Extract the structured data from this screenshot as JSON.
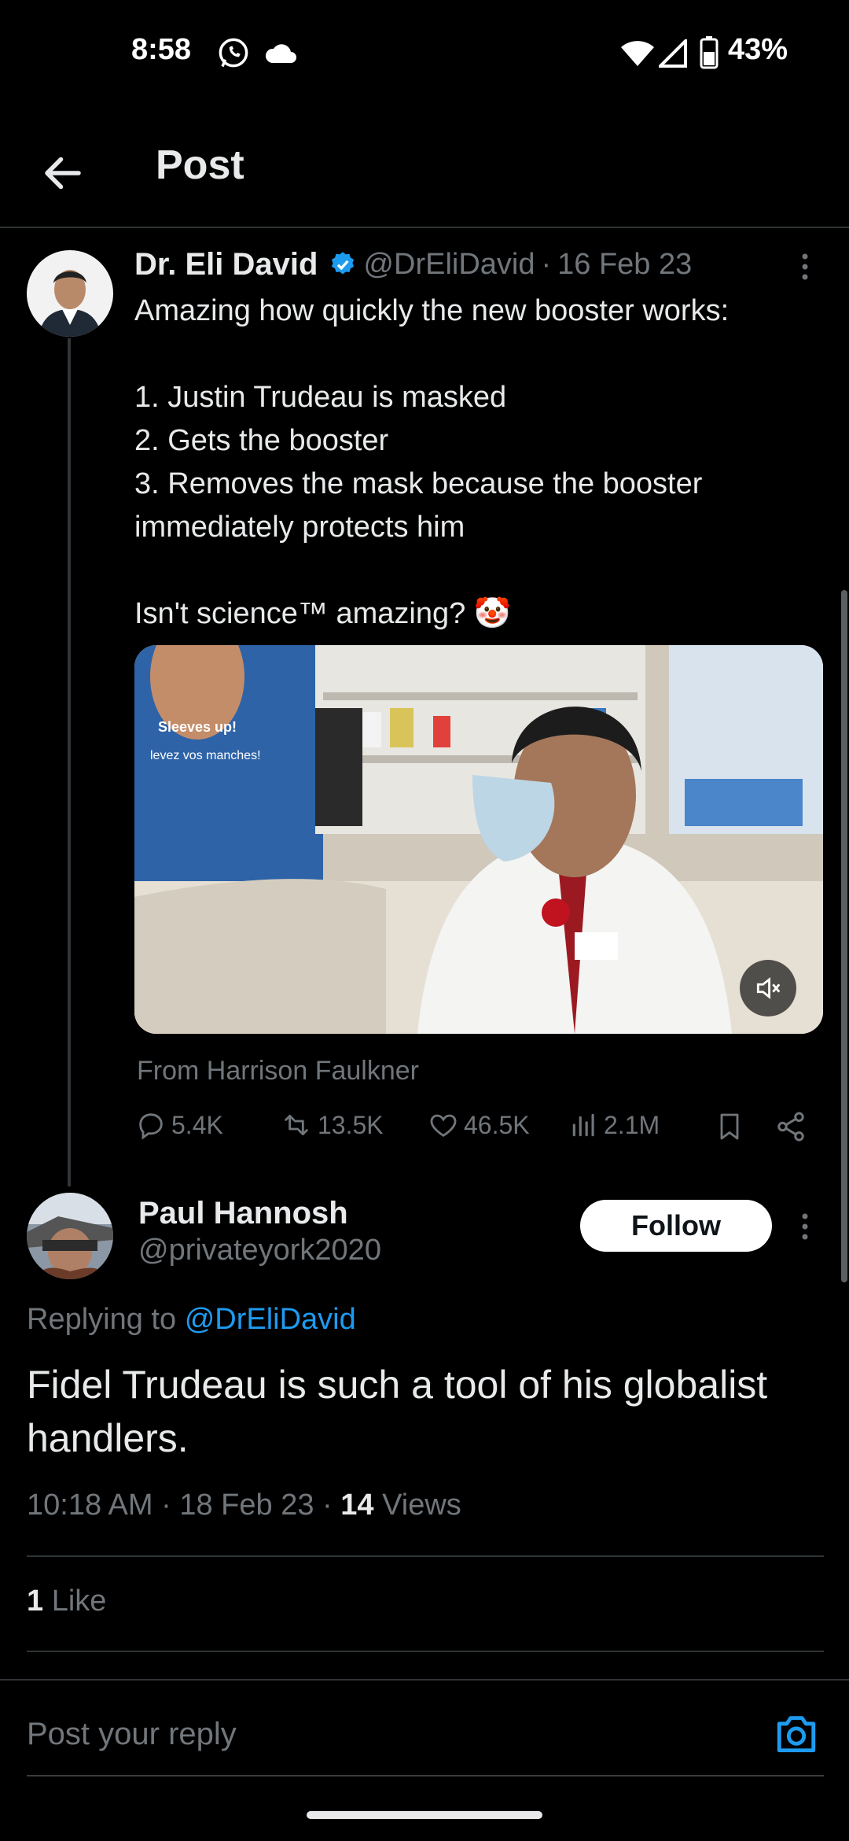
{
  "status_bar": {
    "time": "8:58",
    "battery": "43%"
  },
  "header": {
    "title": "Post"
  },
  "parent_post": {
    "author_name": "Dr. Eli David",
    "author_handle": "@DrEliDavid",
    "separator": "·",
    "date": "16 Feb 23",
    "body": "Amazing how quickly the new booster works:\n\n1. Justin Trudeau is masked\n2. Gets the booster\n3. Removes the mask because the booster immediately protects him\n\nIsn't science™ amazing? 🤡",
    "media_text": {
      "poster_line1": "Sleeves up!",
      "poster_line2": "levez vos manches!"
    },
    "attribution": "From Harrison Faulkner",
    "stats": {
      "replies": "5.4K",
      "reposts": "13.5K",
      "likes": "46.5K",
      "views": "2.1M"
    }
  },
  "reply_post": {
    "author_name": "Paul Hannosh",
    "author_handle": "@privateyork2020",
    "follow_label": "Follow",
    "replying_prefix": "Replying to",
    "replying_handle": "@DrEliDavid",
    "text": "Fidel Trudeau is such a tool of his globalist handlers.",
    "time": "10:18 AM",
    "date": "18 Feb 23",
    "views_count": "14",
    "views_label": "Views",
    "likes_count": "1",
    "likes_label": "Like"
  },
  "composer": {
    "placeholder": "Post your reply"
  },
  "colors": {
    "accent": "#1d9bf0",
    "background": "#000000",
    "text": "#e7e9ea",
    "muted": "#71767b"
  }
}
